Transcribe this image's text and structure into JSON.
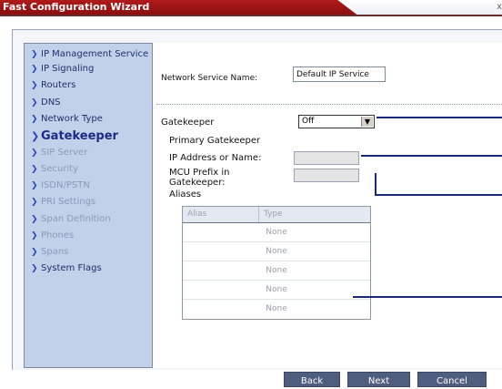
{
  "window": {
    "title": "Fast Configuration Wizard",
    "close_glyph": "x"
  },
  "sidebar": {
    "items": [
      {
        "label": "IP Management Service",
        "state": "normal"
      },
      {
        "label": "IP Signaling",
        "state": "normal"
      },
      {
        "label": "Routers",
        "state": "normal"
      },
      {
        "label": "DNS",
        "state": "normal"
      },
      {
        "label": "Network Type",
        "state": "normal"
      },
      {
        "label": "Gatekeeper",
        "state": "active"
      },
      {
        "label": "SIP Server",
        "state": "disabled"
      },
      {
        "label": "Security",
        "state": "disabled"
      },
      {
        "label": "ISDN/PSTN",
        "state": "disabled"
      },
      {
        "label": "PRI Settings",
        "state": "disabled"
      },
      {
        "label": "Span Definition",
        "state": "disabled"
      },
      {
        "label": "Phones",
        "state": "disabled"
      },
      {
        "label": "Spans",
        "state": "disabled"
      },
      {
        "label": "System Flags",
        "state": "normal"
      }
    ]
  },
  "form": {
    "network_service_label": "Network Service Name:",
    "network_service_value": "Default IP Service",
    "gatekeeper_label": "Gatekeeper",
    "gatekeeper_value": "Off",
    "primary_gatekeeper_label": "Primary Gatekeeper",
    "ip_address_label": "IP Address or Name:",
    "ip_address_value": "",
    "mcu_prefix_label_line1": "MCU Prefix in",
    "mcu_prefix_label_line2": "Gatekeeper:",
    "mcu_prefix_value": "",
    "aliases_label": "Aliases"
  },
  "aliases_table": {
    "columns": [
      "Alias",
      "Type"
    ],
    "rows": [
      {
        "alias": "",
        "type": "None"
      },
      {
        "alias": "",
        "type": "None"
      },
      {
        "alias": "",
        "type": "None"
      },
      {
        "alias": "",
        "type": "None"
      },
      {
        "alias": "",
        "type": "None"
      }
    ]
  },
  "buttons": {
    "back": "Back",
    "next": "Next",
    "cancel": "Cancel"
  },
  "colors": {
    "title_bar": "#b01a1a",
    "sidebar_bg": "#c2d1ea",
    "active_item": "#1a2a88",
    "button_bg": "#4f5e7e",
    "callout_line": "#1a2a7a"
  },
  "icons": {
    "nav_chevron": "chevron-right-icon",
    "dropdown_arrow": "chevron-down-icon",
    "close": "close-icon"
  }
}
